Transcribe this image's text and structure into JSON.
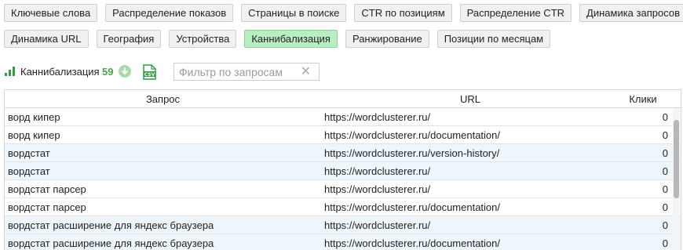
{
  "tabs": {
    "row1": [
      {
        "label": "Ключевые слова",
        "active": false
      },
      {
        "label": "Распределение показов",
        "active": false
      },
      {
        "label": "Страницы в поиске",
        "active": false
      },
      {
        "label": "CTR по позициям",
        "active": false
      },
      {
        "label": "Распределение CTR",
        "active": false
      },
      {
        "label": "Динамика запросов",
        "active": false
      }
    ],
    "row2": [
      {
        "label": "Динамика URL",
        "active": false
      },
      {
        "label": "География",
        "active": false
      },
      {
        "label": "Устройства",
        "active": false
      },
      {
        "label": "Каннибализация",
        "active": true
      },
      {
        "label": "Ранжирование",
        "active": false
      },
      {
        "label": "Позиции по месяцам",
        "active": false
      }
    ]
  },
  "toolbar": {
    "label": "Каннибализация",
    "count": "59",
    "csv_icon_text": "CSV",
    "filter_placeholder": "Фильтр по запросам",
    "accent_color": "#2f9e3e"
  },
  "table": {
    "columns": {
      "query": "Запрос",
      "url": "URL",
      "clicks": "Клики"
    },
    "rows": [
      {
        "query": "ворд кипер",
        "url": "https://wordclusterer.ru/",
        "clicks": "0"
      },
      {
        "query": "ворд кипер",
        "url": "https://wordclusterer.ru/documentation/",
        "clicks": "0"
      },
      {
        "query": "вордстат",
        "url": "https://wordclusterer.ru/version-history/",
        "clicks": "0"
      },
      {
        "query": "вордстат",
        "url": "https://wordclusterer.ru/",
        "clicks": "0"
      },
      {
        "query": "вордстат парсер",
        "url": "https://wordclusterer.ru/",
        "clicks": "0"
      },
      {
        "query": "вордстат парсер",
        "url": "https://wordclusterer.ru/documentation/",
        "clicks": "0"
      },
      {
        "query": "вордстат расширение для яндекс браузера",
        "url": "https://wordclusterer.ru/",
        "clicks": "0"
      },
      {
        "query": "вордстат расширение для яндекс браузера",
        "url": "https://wordclusterer.ru/documentation/",
        "clicks": "0"
      }
    ]
  }
}
